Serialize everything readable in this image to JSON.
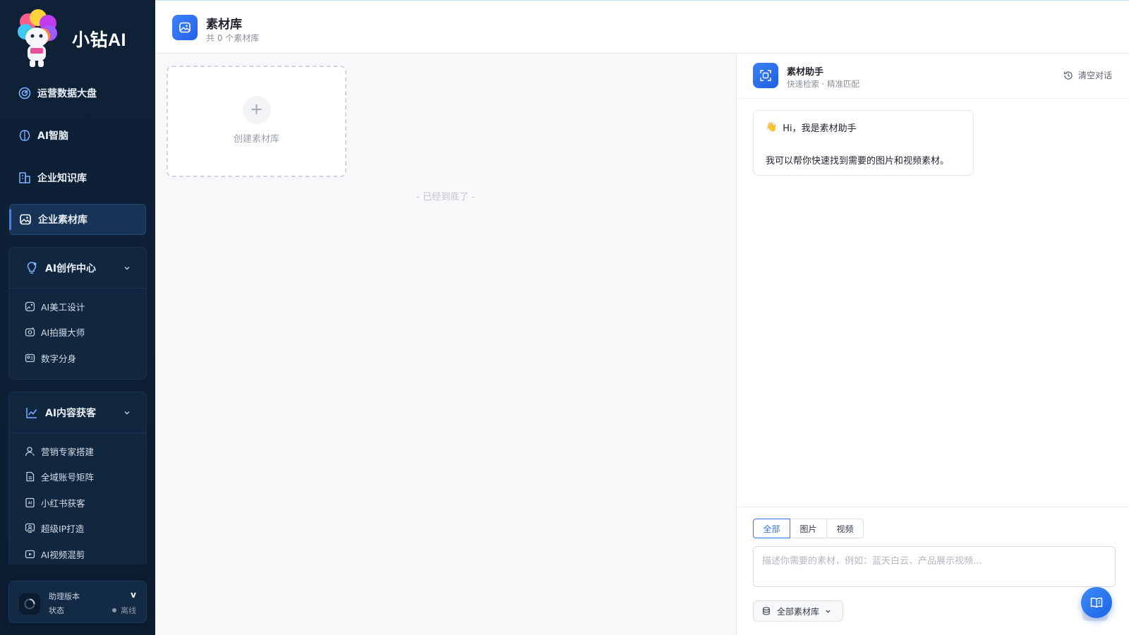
{
  "brand": {
    "name": "小钻AI",
    "mascot_badge": "小钻AI"
  },
  "sidebar": {
    "items": [
      {
        "label": "运营数据大盘",
        "icon": "dashboard-icon"
      },
      {
        "label": "AI智脑",
        "icon": "brain-icon"
      },
      {
        "label": "企业知识库",
        "icon": "building-icon"
      },
      {
        "label": "企业素材库",
        "icon": "image-icon",
        "active": true
      }
    ],
    "groups": [
      {
        "title": "AI创作中心",
        "icon": "lightbulb-icon",
        "expanded": true,
        "items": [
          {
            "label": "AI美工设计",
            "icon": "palette-icon"
          },
          {
            "label": "AI拍摄大师",
            "icon": "camera-icon"
          },
          {
            "label": "数字分身",
            "icon": "id-card-icon"
          }
        ]
      },
      {
        "title": "AI内容获客",
        "icon": "trend-chart-icon",
        "expanded": true,
        "items": [
          {
            "label": "营销专家搭建",
            "icon": "user-icon"
          },
          {
            "label": "全域账号矩阵",
            "icon": "document-icon"
          },
          {
            "label": "小红书获客",
            "icon": "ai-note-icon"
          },
          {
            "label": "超级IP打造",
            "icon": "portrait-icon"
          },
          {
            "label": "AI视频混剪",
            "icon": "video-icon"
          }
        ]
      }
    ],
    "status": {
      "version_label": "助理版本",
      "version_value": "v",
      "status_label": "状态",
      "status_value": "离线"
    }
  },
  "header": {
    "title": "素材库",
    "subtitle": "共 0 个素材库"
  },
  "main": {
    "create_label": "创建素材库",
    "end_text": "- 已经到底了 -"
  },
  "assistant": {
    "title": "素材助手",
    "subtitle": "快速检索 · 精准匹配",
    "clear_label": "清空对话",
    "greeting_emoji": "👋",
    "greeting": "Hi，我是素材助手",
    "intro": "我可以帮你快速找到需要的图片和视频素材。",
    "tabs": [
      {
        "label": "全部",
        "active": true
      },
      {
        "label": "图片",
        "active": false
      },
      {
        "label": "视频",
        "active": false
      }
    ],
    "input_placeholder": "描述你需要的素材，例如：蓝天白云、产品展示视频...",
    "library_select": "全部素材库"
  },
  "colors": {
    "sidebar_bg": "#0f2136",
    "accent": "#2f76e8",
    "active_item_bg": "#173456"
  }
}
